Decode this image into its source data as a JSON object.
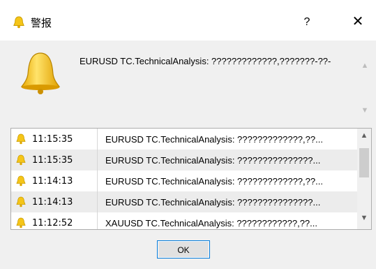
{
  "window": {
    "title": "警报",
    "icon": "bell-icon",
    "help_label": "?",
    "close_label": "✕"
  },
  "message": {
    "text": "EURUSD TC.TechnicalAnalysis: ?????????????,???????-??-"
  },
  "alerts": [
    {
      "time": "11:15:35",
      "message": "EURUSD TC.TechnicalAnalysis: ?????????????,??..."
    },
    {
      "time": "11:15:35",
      "message": "EURUSD TC.TechnicalAnalysis: ???????????????..."
    },
    {
      "time": "11:14:13",
      "message": "EURUSD TC.TechnicalAnalysis: ?????????????,??..."
    },
    {
      "time": "11:14:13",
      "message": "EURUSD TC.TechnicalAnalysis: ???????????????..."
    },
    {
      "time": "11:12:52",
      "message": "XAUUSD TC.TechnicalAnalysis: ????????????,??..."
    }
  ],
  "ok_label": "OK",
  "colors": {
    "bell": "#f5c518",
    "focus": "#0078d7"
  }
}
